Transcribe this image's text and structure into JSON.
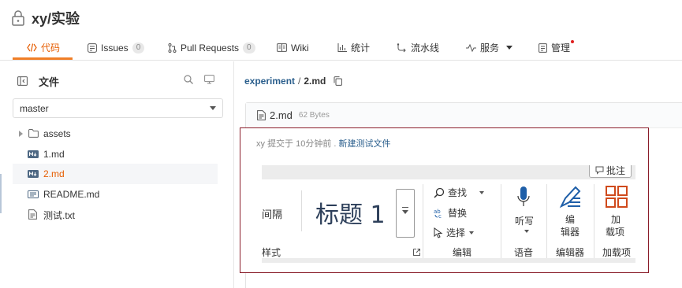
{
  "repo": {
    "name": "xy/实验"
  },
  "tabs": [
    {
      "label": "代码"
    },
    {
      "label": "Issues",
      "count": "0"
    },
    {
      "label": "Pull Requests",
      "count": "0"
    },
    {
      "label": "Wiki"
    },
    {
      "label": "统计"
    },
    {
      "label": "流水线"
    },
    {
      "label": "服务"
    },
    {
      "label": "管理"
    }
  ],
  "sidebar": {
    "title": "文件",
    "branch": "master",
    "tree": [
      {
        "label": "assets",
        "type": "folder"
      },
      {
        "label": "1.md",
        "type": "md"
      },
      {
        "label": "2.md",
        "type": "md"
      },
      {
        "label": "README.md",
        "type": "readme"
      },
      {
        "label": "测试.txt",
        "type": "txt"
      }
    ]
  },
  "breadcrumb": {
    "repo": "experiment",
    "sep": "/",
    "file": "2.md"
  },
  "file": {
    "name": "2.md",
    "size": "62 Bytes"
  },
  "commit": {
    "author": "xy",
    "time": "提交于 10分钟前 .",
    "message": "新建测试文件"
  },
  "ribbon": {
    "comment": "批注",
    "spacing_label": "间隔",
    "heading_style": "标题 1",
    "styles_label": "样式",
    "find": "查找",
    "replace": "替换",
    "select": "选择",
    "edit_label": "编辑",
    "dictate": "听写",
    "voice_label": "语音",
    "editor_line1": "编",
    "editor_line2": "辑器",
    "editor_label": "编辑器",
    "addins_line1": "加",
    "addins_line2": "载项",
    "addins_label": "加载项"
  },
  "colors": {
    "accent": "#f07e26",
    "link": "#2a5e8c",
    "highlight_border": "#8a1d2a"
  }
}
